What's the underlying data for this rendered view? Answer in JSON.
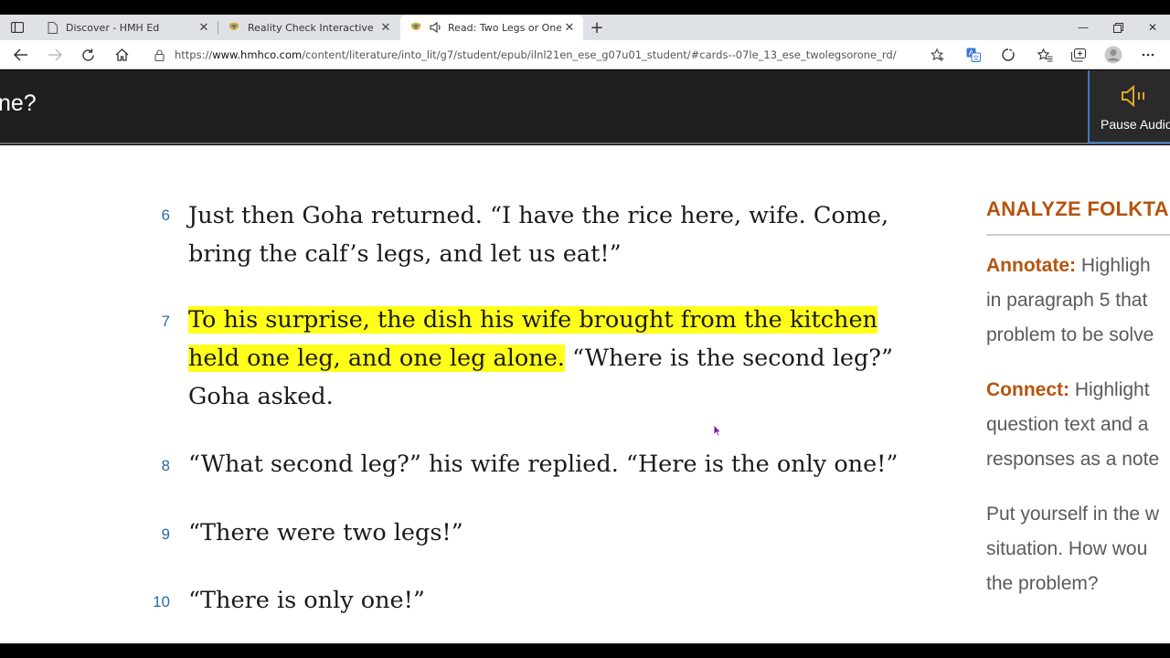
{
  "browser": {
    "tabs": [
      {
        "title": "Discover - HMH Ed",
        "icon": "page-icon"
      },
      {
        "title": "Reality Check Interactive Unit Pla",
        "icon": "hmh-logo-icon"
      },
      {
        "title": "Read: Two Legs or One? - H",
        "icon": "hmh-logo-icon",
        "audio": "speaker-icon",
        "active": true
      }
    ],
    "url_prefix": "https://",
    "url_host": "www.hmhco.com",
    "url_path": "/content/literature/into_lit/g7/student/epub/ilnl21en_ese_g07u01_student/#cards--07le_13_ese_twolegsorone_rd/"
  },
  "header": {
    "title": "ne?",
    "audio_label": "Pause Audio"
  },
  "paragraphs": [
    {
      "num": "6",
      "text": "Just then Goha returned. “I have the rice here, wife. Come, bring the calf’s legs, and let us eat!”"
    },
    {
      "num": "7",
      "highlight": "To his surprise, the dish his wife brought from the kitchen held one leg, and one leg alone.",
      "text": " “Where is the second leg?” Goha asked."
    },
    {
      "num": "8",
      "text": "“What second leg?” his wife replied. “Here is the only one!”"
    },
    {
      "num": "9",
      "text": "“There were two legs!”"
    },
    {
      "num": "10",
      "text": "“There is only one!”"
    }
  ],
  "sidebar": {
    "heading": "ANALYZE FOLKTAL",
    "annotate_key": "Annotate:",
    "annotate_lines": [
      " Highligh",
      "in paragraph 5 that",
      "problem to be solve"
    ],
    "connect_key": "Connect:",
    "connect_lines": [
      " Highlight",
      "question text and a",
      "responses as a note"
    ],
    "prompt_lines": [
      "Put yourself in the w",
      "situation. How wou",
      "the problem?"
    ]
  },
  "colors": {
    "accent": "#b5540f",
    "highlight": "#ffff1a",
    "para_number": "#2b6aa8",
    "header_bg": "#1f1f1f"
  }
}
